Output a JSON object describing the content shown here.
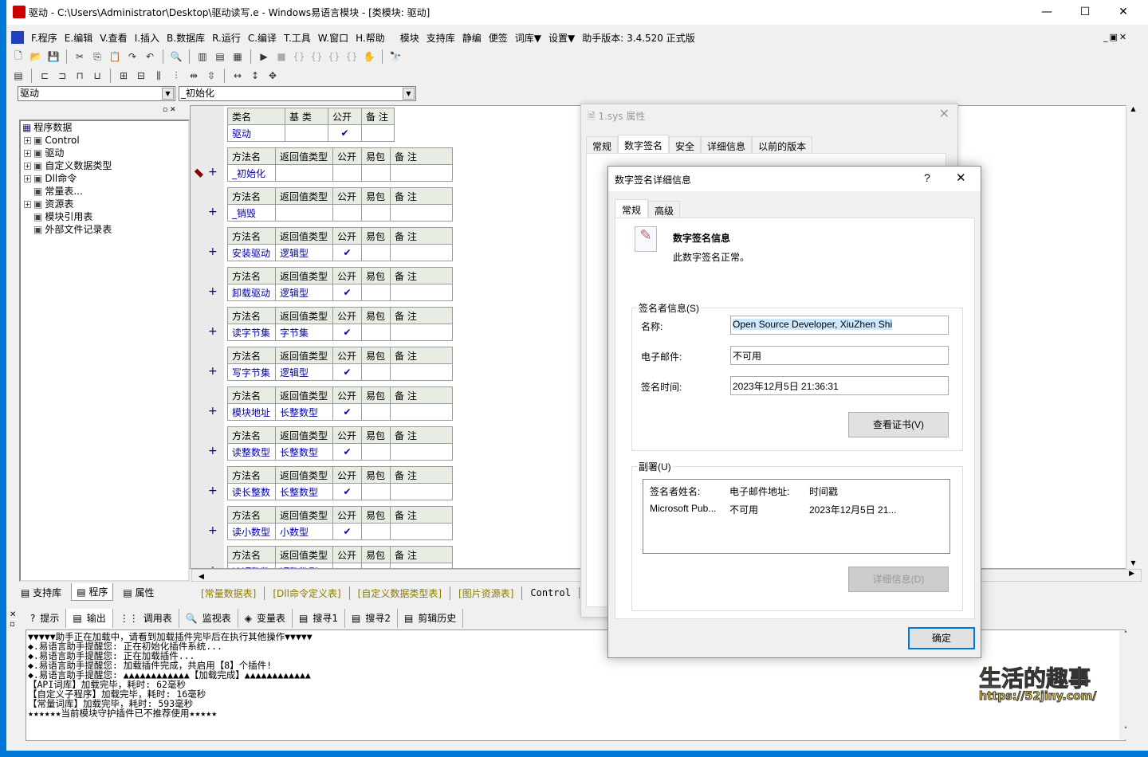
{
  "window": {
    "title": "驱动 - C:\\Users\\Administrator\\Desktop\\驱动读写.e - Windows易语言模块 - [类模块: 驱动]"
  },
  "menu": [
    "F.程序",
    "E.编辑",
    "V.查看",
    "I.插入",
    "B.数据库",
    "R.运行",
    "C.编译",
    "T.工具",
    "W.窗口",
    "H.帮助",
    "模块",
    "支持库",
    "静编",
    "便签",
    "词库▼",
    "设置▼",
    "助手版本: 3.4.520 正式版"
  ],
  "combos": {
    "class": "驱动",
    "method": "_初始化"
  },
  "tree": {
    "root": "程序数据",
    "items": [
      {
        "label": "Control",
        "expand": true
      },
      {
        "label": "驱动",
        "expand": true
      },
      {
        "label": "自定义数据类型",
        "expand": true
      },
      {
        "label": "Dll命令",
        "expand": true
      },
      {
        "label": "常量表...",
        "expand": false
      },
      {
        "label": "资源表",
        "expand": true
      },
      {
        "label": "模块引用表",
        "expand": false
      },
      {
        "label": "外部文件记录表",
        "expand": false
      }
    ]
  },
  "left_tabs": [
    "支持库",
    "程序",
    "属性"
  ],
  "class_table": {
    "headers": [
      "类名",
      "基 类",
      "公开",
      "备 注"
    ],
    "row": [
      "驱动",
      "",
      "✔",
      ""
    ]
  },
  "method_headers": [
    "方法名",
    "返回值类型",
    "公开",
    "易包",
    "备 注"
  ],
  "methods": [
    {
      "name": "_初始化",
      "ret": "",
      "public": false
    },
    {
      "name": "_销毁",
      "ret": "",
      "public": false
    },
    {
      "name": "安装驱动",
      "ret": "逻辑型",
      "public": true
    },
    {
      "name": "卸载驱动",
      "ret": "逻辑型",
      "public": true
    },
    {
      "name": "读字节集",
      "ret": "字节集",
      "public": true
    },
    {
      "name": "写字节集",
      "ret": "逻辑型",
      "public": true
    },
    {
      "name": "模块地址",
      "ret": "长整数型",
      "public": true
    },
    {
      "name": "读整数型",
      "ret": "长整数型",
      "public": true
    },
    {
      "name": "读长整数",
      "ret": "长整数型",
      "public": true
    },
    {
      "name": "读小数型",
      "ret": "小数型",
      "public": true
    },
    {
      "name": "读短整数",
      "ret": "短整数型",
      "public": true
    }
  ],
  "bottom_tabs": [
    "[常量数据表]",
    "[Dll命令定义表]",
    "[自定义数据类型表]",
    "[图片资源表]",
    "Control"
  ],
  "output_tabs": [
    "提示",
    "输出",
    "调用表",
    "监视表",
    "变量表",
    "搜寻1",
    "搜寻2",
    "剪辑历史"
  ],
  "output_lines": [
    "▼▼▼▼▼助手正在加载中，请看到加载插件完毕后在执行其他操作▼▼▼▼▼",
    "◆.易语言助手提醒您: 正在初始化插件系统...",
    "◆.易语言助手提醒您: 正在加载插件...",
    "◆.易语言助手提醒您: 加载插件完成，共启用【8】个插件!",
    "◆.易语言助手提醒您: ▲▲▲▲▲▲▲▲▲▲▲▲【加载完成】▲▲▲▲▲▲▲▲▲▲▲▲",
    "【API词库】加载完毕，耗时: 62毫秒",
    "【自定义子程序】加载完毕，耗时: 16毫秒",
    "【常量词库】加载完毕，耗时: 593毫秒",
    "★★★★★★当前模块守护插件已不推荐使用★★★★★"
  ],
  "props": {
    "title": "1.sys 属性",
    "tabs": [
      "常规",
      "数字签名",
      "安全",
      "详细信息",
      "以前的版本"
    ],
    "active": "数字签名"
  },
  "dialog": {
    "title": "数字签名详细信息",
    "help": "?",
    "tabs": [
      "常规",
      "高级"
    ],
    "heading": "数字签名信息",
    "status": "此数字签名正常。",
    "signer_group": "签名者信息(S)",
    "name_label": "名称:",
    "name_value": "Open Source Developer, XiuZhen Shi",
    "email_label": "电子邮件:",
    "email_value": "不可用",
    "time_label": "签名时间:",
    "time_value": "2023年12月5日 21:36:31",
    "view_cert": "查看证书(V)",
    "counter_group": "副署(U)",
    "counter_headers": [
      "签名者姓名:",
      "电子邮件地址:",
      "时间戳"
    ],
    "counter_row": [
      "Microsoft Pub...",
      "不可用",
      "2023年12月5日 21..."
    ],
    "details_btn": "详细信息(D)",
    "ok": "确定"
  },
  "watermark": {
    "line1": "生活的趣事",
    "line2": "https://52jiny.com/"
  }
}
